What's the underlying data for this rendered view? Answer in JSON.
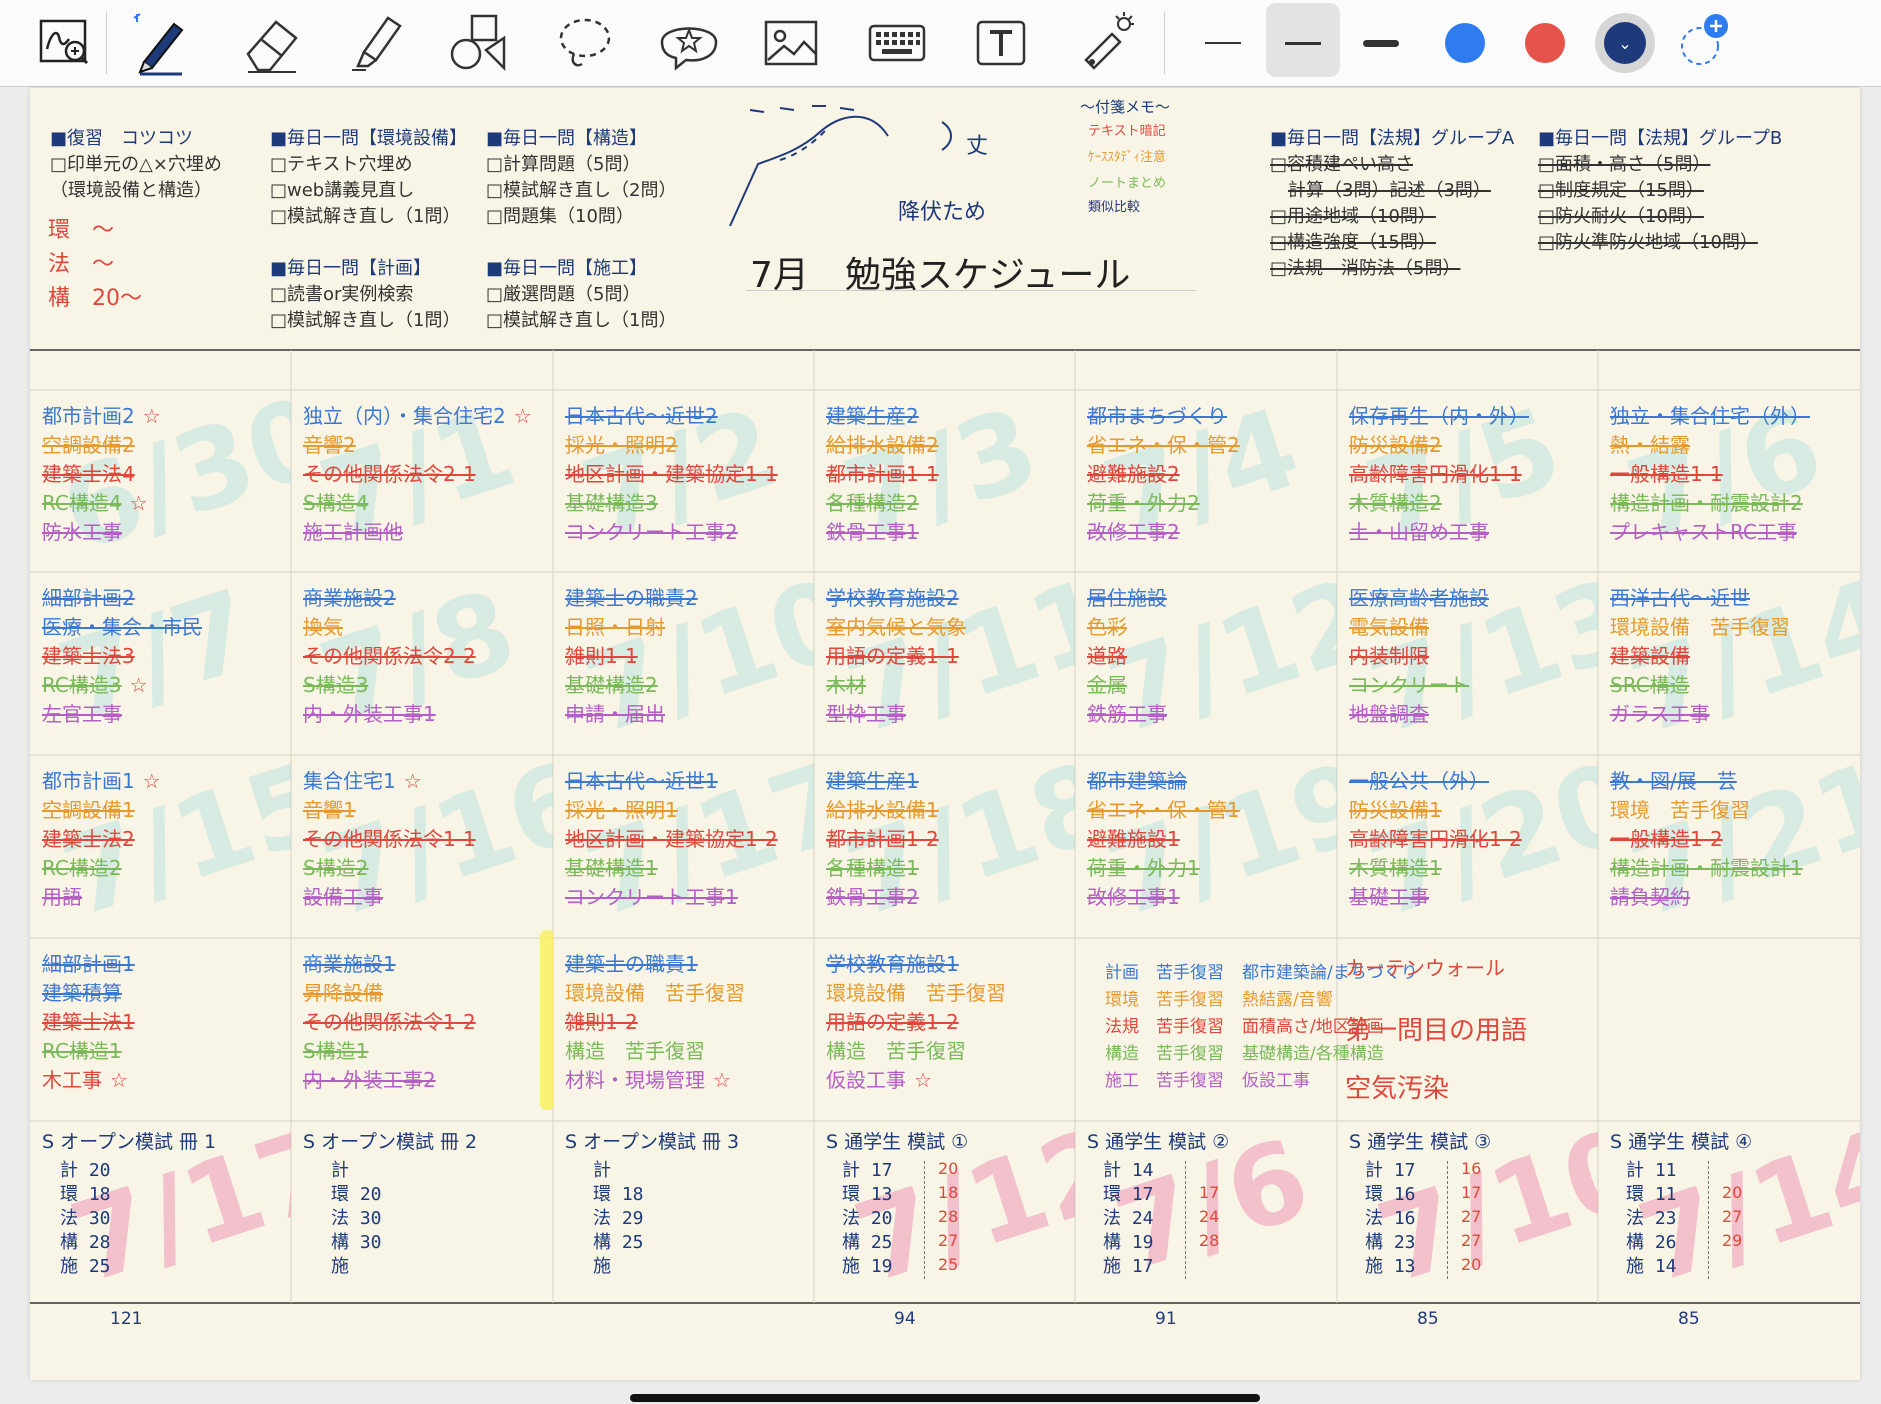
{
  "toolbar": {
    "tools": [
      {
        "name": "lasso-zoom",
        "active": false
      },
      {
        "name": "pen",
        "active": true
      },
      {
        "name": "eraser",
        "active": false
      },
      {
        "name": "highlighter",
        "active": false
      },
      {
        "name": "shapes",
        "active": false
      },
      {
        "name": "lasso",
        "active": false
      },
      {
        "name": "sticker",
        "active": false
      },
      {
        "name": "image",
        "active": false
      },
      {
        "name": "keyboard",
        "active": false
      },
      {
        "name": "text",
        "active": false
      },
      {
        "name": "laser-pointer",
        "active": false
      }
    ],
    "stroke_widths": [
      "thin",
      "medium",
      "thick"
    ],
    "selected_width": "medium",
    "colors": [
      "#2f7bf0",
      "#e5534b",
      "#1e3a7b"
    ],
    "selected_color": "#1e3a7b"
  },
  "header": {
    "col1": {
      "title": "■復習　コツコツ",
      "lines": [
        "□印単元の△×穴埋め",
        "（環境設備と構造）"
      ],
      "hand": [
        "環　～",
        "法　～",
        "構　20～"
      ]
    },
    "col2": {
      "title": "■毎日一問【環境設備】",
      "lines": [
        "□テキスト穴埋め",
        "□web講義見直し",
        "□模試解き直し（1問）"
      ],
      "title2": "■毎日一問【計画】",
      "lines2": [
        "□読書or実例検索",
        "□模試解き直し（1問）"
      ]
    },
    "col3": {
      "title": "■毎日一問【構造】",
      "lines": [
        "□計算問題（5問）",
        "□模試解き直し（2問）",
        "□問題集（10問）"
      ],
      "title2": "■毎日一問【施工】",
      "lines2": [
        "□厳選問題（5問）",
        "□模試解き直し（1問）"
      ]
    },
    "center": {
      "title": "7月　勉強スケジュール",
      "sketch1": "丈",
      "sketch2": "降伏ため"
    },
    "notes": {
      "title": "～付箋メモ～",
      "lines": [
        "テキスト暗記",
        "ｹｰｽｽﾀﾃﾞｨ注意",
        "ノートまとめ",
        "類似比較"
      ]
    },
    "col4": {
      "title": "■毎日一問【法規】グループA",
      "lines": [
        "□容積建ぺい高さ",
        "計算（3問）記述（3問）",
        "□用途地域（10問）",
        "□構造強度（15問）",
        "□法規　消防法（5問）"
      ]
    },
    "col5": {
      "title": "■毎日一問【法規】グループB",
      "lines": [
        "□面積・高さ（5問）",
        "□制度規定（15問）",
        "□防火耐火（10問）",
        "□防火準防火地域（10問）"
      ]
    }
  },
  "weeks": [
    {
      "cells": [
        {
          "date": "6/30",
          "items": [
            [
              "都市計画2",
              "blue",
              false,
              true
            ],
            [
              "空調設備2",
              "orange",
              true
            ],
            [
              "建築士法4",
              "red",
              true
            ],
            [
              "RC構造4",
              "green",
              true,
              true
            ],
            [
              "防水工事",
              "purple",
              true
            ]
          ]
        },
        {
          "date": "7/1",
          "items": [
            [
              "独立（内）・集合住宅2",
              "blue",
              false,
              true
            ],
            [
              "音響2",
              "orange",
              true
            ],
            [
              "その他関係法令2-1",
              "red",
              true
            ],
            [
              "S構造4",
              "green",
              true
            ],
            [
              "施工計画他",
              "purple",
              true
            ]
          ]
        },
        {
          "date": "7/2",
          "items": [
            [
              "日本古代〜近世2",
              "blue",
              true
            ],
            [
              "採光・照明2",
              "orange",
              true
            ],
            [
              "地区計画・建築協定1-1",
              "red",
              true
            ],
            [
              "基礎構造3",
              "green",
              true
            ],
            [
              "コンクリート工事2",
              "purple",
              true
            ]
          ]
        },
        {
          "date": "7/3",
          "items": [
            [
              "建築生産2",
              "blue",
              true
            ],
            [
              "給排水設備2",
              "orange",
              true
            ],
            [
              "都市計画1-1",
              "red",
              true
            ],
            [
              "各種構造2",
              "green",
              true
            ],
            [
              "鉄骨工事1",
              "purple",
              true
            ]
          ]
        },
        {
          "date": "7/4",
          "items": [
            [
              "都市まちづくり",
              "blue",
              true
            ],
            [
              "省エネ・保・管2",
              "orange",
              true
            ],
            [
              "避難施設2",
              "red",
              true
            ],
            [
              "荷重・外力2",
              "green",
              true
            ],
            [
              "改修工事2",
              "purple",
              true
            ]
          ]
        },
        {
          "date": "7/5",
          "items": [
            [
              "保存再生（内・外）",
              "blue",
              true
            ],
            [
              "防災設備2",
              "orange",
              true
            ],
            [
              "高齢障害円滑化1-1",
              "red",
              true
            ],
            [
              "木質構造2",
              "green",
              true
            ],
            [
              "土・山留め工事",
              "purple",
              true
            ]
          ]
        },
        {
          "date": "7/6",
          "items": [
            [
              "独立・集合住宅（外）",
              "blue",
              true
            ],
            [
              "熱・結露",
              "orange",
              true
            ],
            [
              "一般構造1-1",
              "red",
              true
            ],
            [
              "構造計画・耐震設計2",
              "green",
              true
            ],
            [
              "プレキャストRC工事",
              "purple",
              true
            ]
          ]
        }
      ]
    },
    {
      "cells": [
        {
          "date": "7/7",
          "items": [
            [
              "細部計画2",
              "blue",
              true
            ],
            [
              "医療・集会・市民",
              "blue",
              true
            ],
            [
              "建築士法3",
              "red",
              true
            ],
            [
              "RC構造3",
              "green",
              true,
              true
            ],
            [
              "左官工事",
              "purple",
              true
            ]
          ]
        },
        {
          "date": "7/8",
          "items": [
            [
              "商業施設2",
              "blue",
              true
            ],
            [
              "換気",
              "orange",
              true
            ],
            [
              "その他関係法令2-2",
              "red",
              true
            ],
            [
              "S構造3",
              "green",
              true
            ],
            [
              "内・外装工事1",
              "purple",
              true
            ]
          ]
        },
        {
          "date": "7/10",
          "items": [
            [
              "建築士の職責2",
              "blue",
              true
            ],
            [
              "日照・日射",
              "orange",
              true
            ],
            [
              "雑則1-1",
              "red",
              true
            ],
            [
              "基礎構造2",
              "green",
              true
            ],
            [
              "申請・届出",
              "purple",
              true
            ]
          ]
        },
        {
          "date": "7/11",
          "items": [
            [
              "学校教育施設2",
              "blue",
              true
            ],
            [
              "室内気候と気象",
              "orange",
              true
            ],
            [
              "用語の定義1-1",
              "red",
              true
            ],
            [
              "木材",
              "green",
              true
            ],
            [
              "型枠工事",
              "purple",
              true
            ]
          ]
        },
        {
          "date": "7/12",
          "items": [
            [
              "居住施設",
              "blue",
              true
            ],
            [
              "色彩",
              "orange",
              true
            ],
            [
              "道路",
              "red",
              true
            ],
            [
              "金属",
              "green",
              true
            ],
            [
              "鉄筋工事",
              "purple",
              true
            ]
          ]
        },
        {
          "date": "7/13",
          "items": [
            [
              "医療高齢者施設",
              "blue",
              true
            ],
            [
              "電気設備",
              "orange",
              true
            ],
            [
              "内装制限",
              "red",
              true
            ],
            [
              "コンクリート",
              "green",
              true
            ],
            [
              "地盤調査",
              "purple",
              true
            ]
          ]
        },
        {
          "date": "7/14",
          "items": [
            [
              "西洋古代〜近世",
              "blue",
              true
            ],
            [
              "環境設備　苦手復習",
              "orange",
              false
            ],
            [
              "建築設備",
              "red",
              true
            ],
            [
              "SRC構造",
              "green",
              true
            ],
            [
              "ガラス工事",
              "purple",
              true
            ]
          ]
        }
      ]
    },
    {
      "cells": [
        {
          "date": "7/15",
          "items": [
            [
              "都市計画1",
              "blue",
              false,
              true
            ],
            [
              "空調設備1",
              "orange",
              true
            ],
            [
              "建築士法2",
              "red",
              true
            ],
            [
              "RC構造2",
              "green",
              true
            ],
            [
              "用語",
              "purple",
              true
            ]
          ]
        },
        {
          "date": "7/16",
          "items": [
            [
              "集合住宅1",
              "blue",
              false,
              true
            ],
            [
              "音響1",
              "orange",
              true
            ],
            [
              "その他関係法令1-1",
              "red",
              true
            ],
            [
              "S構造2",
              "green",
              true
            ],
            [
              "設備工事",
              "purple",
              true
            ]
          ]
        },
        {
          "date": "7/17",
          "items": [
            [
              "日本古代〜近世1",
              "blue",
              true
            ],
            [
              "採光・照明1",
              "orange",
              true
            ],
            [
              "地区計画・建築協定1-2",
              "red",
              true
            ],
            [
              "基礎構造1",
              "green",
              true
            ],
            [
              "コンクリート工事1",
              "purple",
              true
            ]
          ]
        },
        {
          "date": "7/18",
          "items": [
            [
              "建築生産1",
              "blue",
              true
            ],
            [
              "給排水設備1",
              "orange",
              true
            ],
            [
              "都市計画1-2",
              "red",
              true
            ],
            [
              "各種構造1",
              "green",
              true
            ],
            [
              "鉄骨工事2",
              "purple",
              true
            ]
          ]
        },
        {
          "date": "7/19",
          "items": [
            [
              "都市建築論",
              "blue",
              true
            ],
            [
              "省エネ・保・管1",
              "orange",
              true
            ],
            [
              "避難施設1",
              "red",
              true
            ],
            [
              "荷重・外力1",
              "green",
              true
            ],
            [
              "改修工事1",
              "purple",
              true
            ]
          ]
        },
        {
          "date": "7/20",
          "items": [
            [
              "一般公共（外）",
              "blue",
              true
            ],
            [
              "防災設備1",
              "orange",
              true
            ],
            [
              "高齢障害円滑化1-2",
              "red",
              true
            ],
            [
              "木質構造1",
              "green",
              true
            ],
            [
              "基礎工事",
              "purple",
              true
            ]
          ]
        },
        {
          "date": "7/21",
          "items": [
            [
              "教・図/展　芸",
              "blue",
              true
            ],
            [
              "環境　苦手復習",
              "orange",
              false
            ],
            [
              "一般構造1-2",
              "red",
              true
            ],
            [
              "構造計画・耐震設計1",
              "green",
              true
            ],
            [
              "請負契約",
              "purple",
              true
            ]
          ]
        }
      ]
    },
    {
      "cells": [
        {
          "date": "",
          "items": [
            [
              "細部計画1",
              "blue",
              true
            ],
            [
              "建築積算",
              "blue",
              true
            ],
            [
              "建築士法1",
              "red",
              true
            ],
            [
              "RC構造1",
              "green",
              true
            ],
            [
              "木工事",
              "red",
              false,
              true
            ]
          ]
        },
        {
          "date": "",
          "items": [
            [
              "商業施設1",
              "blue",
              true
            ],
            [
              "昇降設備",
              "orange",
              true
            ],
            [
              "その他関係法令1-2",
              "red",
              true
            ],
            [
              "S構造1",
              "green",
              true
            ],
            [
              "内・外装工事2",
              "purple",
              true
            ]
          ]
        },
        {
          "date": "",
          "items": [
            [
              "建築士の職責1",
              "blue",
              true
            ],
            [
              "環境設備　苦手復習",
              "orange",
              false
            ],
            [
              "雑則1-2",
              "red",
              true
            ],
            [
              "構造　苦手復習",
              "green",
              false
            ],
            [
              "材料・現場管理",
              "purple",
              false,
              true
            ]
          ]
        },
        {
          "date": "",
          "items": [
            [
              "学校教育施設1",
              "blue",
              true
            ],
            [
              "環境設備　苦手復習",
              "orange",
              false
            ],
            [
              "用語の定義1-2",
              "red",
              true
            ],
            [
              "構造　苦手復習",
              "green",
              false
            ],
            [
              "仮設工事",
              "purple",
              false,
              true
            ]
          ]
        },
        {
          "legend": [
            [
              "計画　苦手復習",
              "都市建築論/まちづくり",
              "blue"
            ],
            [
              "環境　苦手復習",
              "熱結露/音響",
              "orange"
            ],
            [
              "法規　苦手復習",
              "面積高さ/地区計画",
              "red"
            ],
            [
              "構造　苦手復習",
              "基礎構造/各種構造",
              "green"
            ],
            [
              "施工　苦手復習",
              "仮設工事",
              "purple"
            ]
          ]
        },
        {
          "hand": [
            "カーテンウォール",
            "第一問目の用語",
            "空気汚染"
          ]
        }
      ]
    }
  ],
  "mocks": [
    {
      "title": "S オープン模試 冊 1",
      "date": "7/17",
      "lines": [
        "計 20",
        "環 18",
        "法 30",
        "構 28",
        "施 25"
      ],
      "right": [],
      "total": "121"
    },
    {
      "title": "S オープン模試 冊 2",
      "date": "",
      "lines": [
        "計",
        "環 20",
        "法 30",
        "構 30",
        "施"
      ],
      "right": [],
      "total": ""
    },
    {
      "title": "S オープン模試 冊 3",
      "date": "",
      "lines": [
        "計",
        "環 18",
        "法 29",
        "構 25",
        "施"
      ],
      "right": [],
      "total": ""
    },
    {
      "title": "S 通学生 模試 ①",
      "date": "7/12",
      "lines": [
        "計 17",
        "環 13",
        "法 20",
        "構 25",
        "施 19"
      ],
      "right": [
        "20",
        "18",
        "28",
        "27",
        "25"
      ],
      "total": "94"
    },
    {
      "title": "S 通学生 模試 ②",
      "date": "7/6",
      "lines": [
        "計 14",
        "環 17",
        "法 24",
        "構 19",
        "施 17"
      ],
      "right": [
        "",
        "17",
        "24",
        "28",
        ""
      ],
      "total": "91"
    },
    {
      "title": "S 通学生 模試 ③",
      "date": "7/10",
      "lines": [
        "計 17",
        "環 16",
        "法 16",
        "構 23",
        "施 13"
      ],
      "right": [
        "16",
        "17",
        "27",
        "27",
        "20"
      ],
      "total": "85"
    },
    {
      "title": "S 通学生 模試 ④",
      "date": "7/14",
      "lines": [
        "計 11",
        "環 11",
        "法 23",
        "構 26",
        "施 14"
      ],
      "right": [
        "",
        "20",
        "27",
        "29",
        ""
      ],
      "total": "85"
    }
  ]
}
